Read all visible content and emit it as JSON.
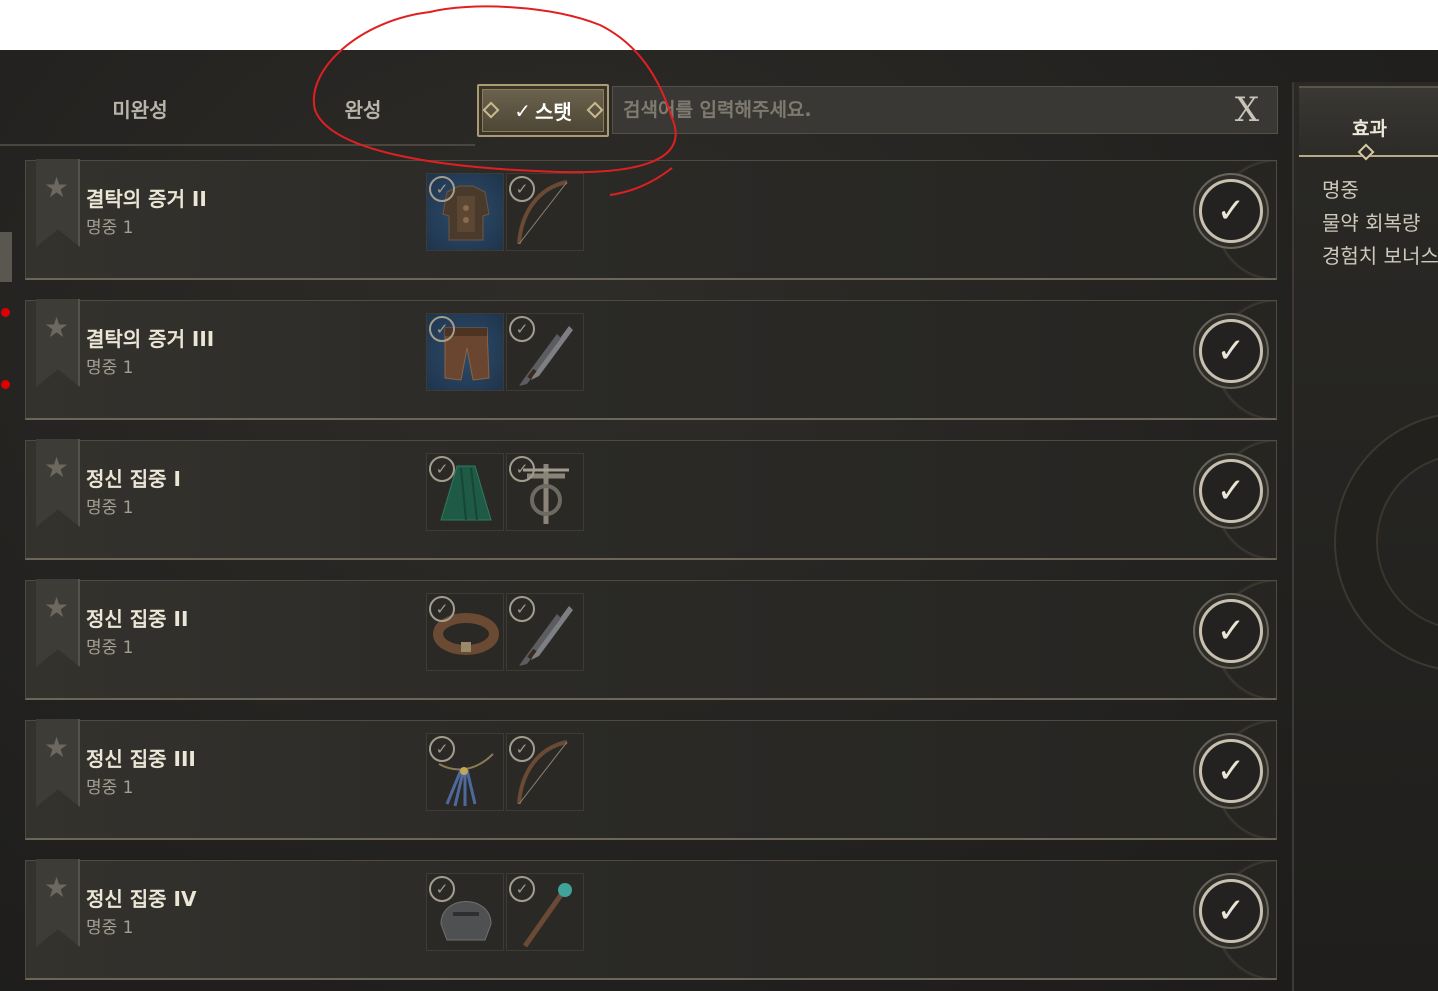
{
  "tabs": {
    "incomplete": "미완성",
    "complete": "완성",
    "stat_check": "✓",
    "stat": "스탯"
  },
  "search": {
    "placeholder": "검색어를 입력해주세요.",
    "clear": "X"
  },
  "effects_panel": {
    "tab_label": "효과",
    "effects": [
      "명중",
      "물약 회복량",
      "경험치 보너스"
    ]
  },
  "quests": [
    {
      "title": "결탁의 증거 II",
      "reward": "명중 1",
      "items": [
        "chest-armor",
        "bow"
      ]
    },
    {
      "title": "결탁의 증거 III",
      "reward": "명중 1",
      "items": [
        "leather-pants",
        "dual-daggers"
      ]
    },
    {
      "title": "정신 집중 I",
      "reward": "명중 1",
      "items": [
        "green-cloak",
        "crossbow"
      ]
    },
    {
      "title": "정신 집중 II",
      "reward": "명중 1",
      "items": [
        "leather-belt",
        "dual-daggers"
      ]
    },
    {
      "title": "정신 집중 III",
      "reward": "명중 1",
      "items": [
        "feather-necklace",
        "bow"
      ]
    },
    {
      "title": "정신 집중 IV",
      "reward": "명중 1",
      "items": [
        "iron-helmet",
        "staff"
      ]
    }
  ],
  "colors": {
    "annotation": "#e02020",
    "accent": "#b9ab86"
  }
}
